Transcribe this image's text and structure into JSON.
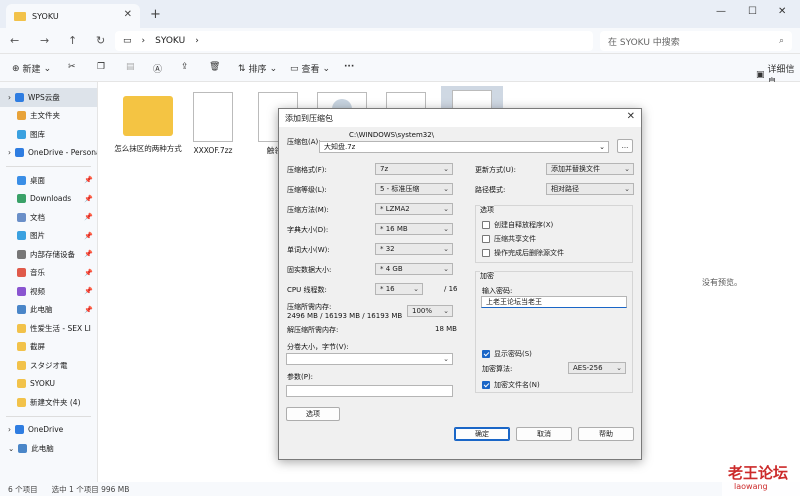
{
  "window": {
    "tab_title": "SYOKU",
    "minimize": "—",
    "maximize": "☐",
    "close": "✕"
  },
  "nav": {
    "path": "SYOKU",
    "search_placeholder": "在 SYOKU 中搜索"
  },
  "toolbar": {
    "new_label": "新建",
    "sort_label": "排序",
    "view_label": "查看",
    "more_label": "···",
    "details_label": "详细信息"
  },
  "sidebar": {
    "items": [
      {
        "label": "WPS云盘",
        "color": "#2f7de1",
        "arrow": ">"
      },
      {
        "label": "主文件夹",
        "color": "#e8a33a",
        "arrow": ""
      },
      {
        "label": "图库",
        "color": "#3aa1e0",
        "arrow": ""
      },
      {
        "label": "OneDrive - Persona",
        "color": "#2f7de1",
        "arrow": ">"
      },
      {
        "label": "桌面",
        "color": "#3a8ee6",
        "pin": true
      },
      {
        "label": "Downloads",
        "color": "#3aa168",
        "pin": true
      },
      {
        "label": "文档",
        "color": "#6a8fc8",
        "pin": true
      },
      {
        "label": "图片",
        "color": "#3aa1e0",
        "pin": true
      },
      {
        "label": "内部存储设备",
        "color": "#777777",
        "pin": true
      },
      {
        "label": "音乐",
        "color": "#e05a4a",
        "pin": true
      },
      {
        "label": "视频",
        "color": "#8a55d0",
        "pin": true
      },
      {
        "label": "此电脑",
        "color": "#4a86c8",
        "pin": true
      },
      {
        "label": "性爱生活 - SEX LI",
        "color": "#f2c24a",
        "pin": true
      },
      {
        "label": "截屏",
        "color": "#f2c24a",
        "pin": false
      },
      {
        "label": "スタジオ電",
        "color": "#f2c24a",
        "pin": false
      },
      {
        "label": "SYOKU",
        "color": "#f2c24a",
        "pin": false
      },
      {
        "label": "新建文件夹 (4)",
        "color": "#f2c24a",
        "pin": false
      },
      {
        "label": "OneDrive",
        "color": "#2f7de1",
        "arrow": ">"
      },
      {
        "label": "此电脑",
        "color": "#4a86c8",
        "arrow": "∨"
      }
    ]
  },
  "files": [
    {
      "name": "怎么抹区的两种方式",
      "kind": "folder"
    },
    {
      "name": "XXXOF.7zz",
      "kind": "file"
    },
    {
      "name": "触领之",
      "kind": "file"
    }
  ],
  "preview": {
    "empty": "没有预览。"
  },
  "status": {
    "count": "6 个项目",
    "selected": "选中 1 个项目  996 MB"
  },
  "dialog": {
    "title": "添加到压缩包",
    "archive_label": "压缩包(A):",
    "archive_dir": "C:\\WINDOWS\\system32\\",
    "archive_name": "大知盘.7z",
    "browse": "...",
    "format_label": "压缩格式(F):",
    "format_value": "7z",
    "level_label": "压缩等级(L):",
    "level_value": "5 - 标准压缩",
    "method_label": "压缩方法(M):",
    "method_value": "* LZMA2",
    "dict_label": "字典大小(D):",
    "dict_value": "* 16 MB",
    "word_label": "单词大小(W):",
    "word_value": "* 32",
    "solid_label": "固实数据大小:",
    "solid_value": "* 4 GB",
    "threads_label": "CPU 线程数:",
    "threads_value": "* 16",
    "threads_total": "/ 16",
    "mem_label": "压缩所需内存:",
    "mem_value": "2496 MB / 16193 MB / 16193 MB",
    "mem_pct": "100%",
    "demem_label": "解压缩所需内存:",
    "demem_value": "18 MB",
    "split_label": "分卷大小，字节(V):",
    "params_label": "参数(P):",
    "options_btn": "选项",
    "update_label": "更新方式(U):",
    "update_value": "添加并替换文件",
    "path_label": "路径模式:",
    "path_value": "相对路径",
    "opts_title": "选项",
    "opt_sfx": "创建自释放程序(X)",
    "opt_shared": "压缩共享文件",
    "opt_delete": "操作完成后删除源文件",
    "enc_title": "加密",
    "pwd_label": "输入密码:",
    "pwd_value": "上老王论坛当老王",
    "show_pwd": "显示密码(S)",
    "enc_method_label": "加密算法:",
    "enc_method_value": "AES-256",
    "enc_names": "加密文件名(N)",
    "ok": "确定",
    "cancel": "取消",
    "help": "帮助"
  },
  "watermark": {
    "title": "老王论坛",
    "sub": "laowang"
  }
}
